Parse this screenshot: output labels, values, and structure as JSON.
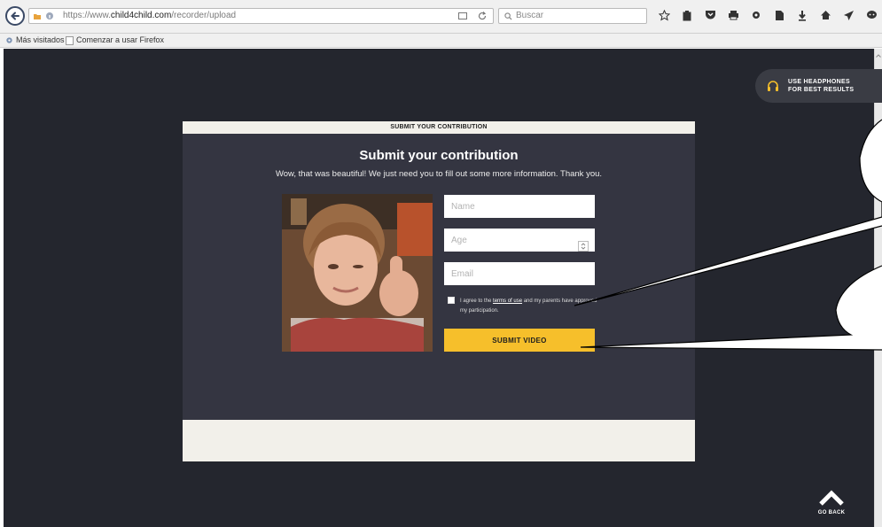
{
  "browser": {
    "url_prefix": "https://www.",
    "url_domain": "child4child.com",
    "url_path": "/recorder/upload",
    "search_placeholder": "Buscar",
    "bookmarks": [
      "Más visitados",
      "Comenzar a usar Firefox"
    ]
  },
  "page": {
    "headphones_line1": "USE HEADPHONES",
    "headphones_line2": "FOR BEST RESULTS",
    "modal_header": "SUBMIT YOUR CONTRIBUTION",
    "title": "Submit your contribution",
    "subtitle": "Wow, that was beautiful! We just need you to fill out some more information. Thank you.",
    "form": {
      "name_placeholder": "Name",
      "age_placeholder": "Age",
      "email_placeholder": "Email",
      "terms_before": "I agree to the ",
      "terms_link": "terms of use",
      "terms_after": " and my parents have approved my participation.",
      "submit_label": "SUBMIT VIDEO"
    },
    "go_back": "GO BACK"
  },
  "colors": {
    "page_bg": "#24262e",
    "modal_body": "#343541",
    "modal_bars": "#f2f0ea",
    "accent": "#f6bf2b"
  }
}
